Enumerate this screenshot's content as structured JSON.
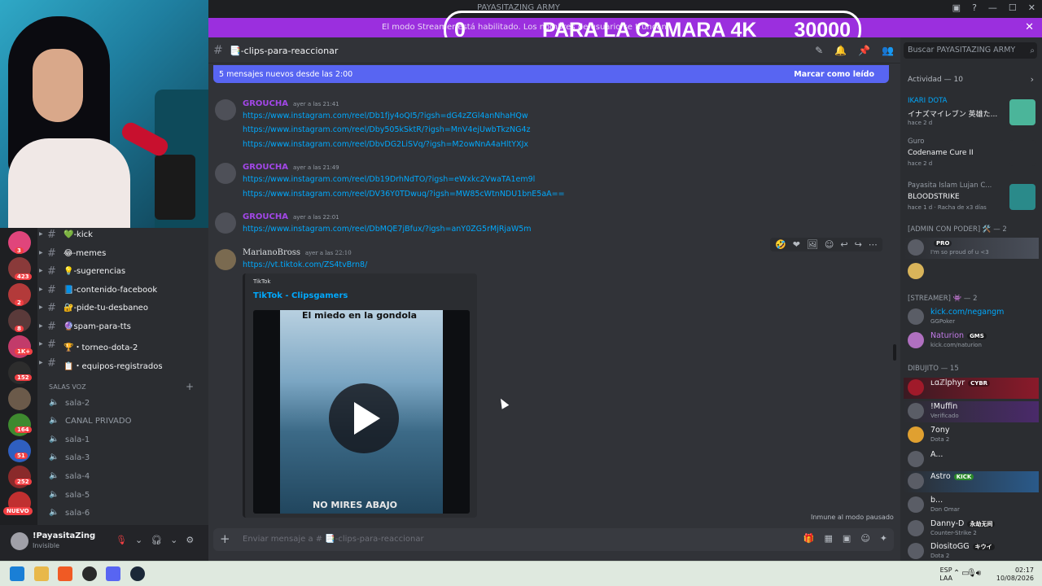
{
  "window": {
    "title": "PAYASITAZING ARMY",
    "controls": [
      "▣",
      "?",
      "—",
      "☐",
      "✕"
    ]
  },
  "banner": {
    "text": "El modo Streamer está habilitado. Los nombres de usuario se truncan.",
    "close": "✕"
  },
  "overlay": {
    "left": "0",
    "middle": "PARA LA CAMARA 4K",
    "right": "30000"
  },
  "channel_header": {
    "hash": "#",
    "name": "📑-clips-para-reaccionar"
  },
  "search": {
    "placeholder": "Buscar PAYASITAZING ARMY"
  },
  "server_badges": [
    "3",
    "423",
    "2",
    "8",
    "1K+",
    "152",
    "164",
    "51",
    "252"
  ],
  "nuevo_badge": "NUEVO",
  "channels": [
    {
      "name": "💚-kick"
    },
    {
      "name": "😂-memes"
    },
    {
      "name": "💡-sugerencias"
    },
    {
      "name": "📘-contenido-facebook"
    },
    {
      "name": "🔐-pide-tu-desbaneo"
    },
    {
      "name": "🔮spam-para-tts"
    },
    {
      "name": "🏆・torneo-dota-2"
    },
    {
      "name": "📋・equipos-registrados"
    }
  ],
  "voice_header": "SALAS VOZ",
  "voice_channels": [
    "sala-2",
    "CANAL PRIVADO",
    "sala-1",
    "sala-3",
    "sala-4",
    "sala-5",
    "sala-6"
  ],
  "user_panel": {
    "name": "!PayasitaZing",
    "status": "Invisible"
  },
  "new_messages": {
    "text": "5 mensajes nuevos desde las 2:00",
    "mark": "Marcar como leído"
  },
  "messages": [
    {
      "author": "GROUCHA",
      "time": "ayer a las 21:41",
      "links": [
        "https://www.instagram.com/reel/Db1fjy4oQI5/?igsh=dG4zZGl4anNhaHQw",
        "https://www.instagram.com/reel/Dby505kSktR/?igsh=MnV4ejUwbTkzNG4z",
        "https://www.instagram.com/reel/DbvDG2LiSVq/?igsh=M2owNnA4aHltYXJx"
      ]
    },
    {
      "author": "GROUCHA",
      "time": "ayer a las 21:49",
      "links": [
        "https://www.instagram.com/reel/Db19DrhNdTO/?igsh=eWxkc2VwaTA1em9l",
        "https://www.instagram.com/reel/DV36Y0TDwuq/?igsh=MW85cWtnNDU1bnE5aA=="
      ]
    },
    {
      "author": "GROUCHA",
      "time": "ayer a las 22:01",
      "links": [
        "https://www.instagram.com/reel/DbMQE7jBfux/?igsh=anY0ZG5rMjRjaW5m"
      ]
    },
    {
      "author": "MarianoBross",
      "time": "ayer a las 22:10",
      "links": [
        "https://vt.tiktok.com/ZS4tvBrn8/"
      ]
    }
  ],
  "embed": {
    "provider": "TikTok",
    "title": "TikTok - Clipsgamers",
    "video_top": "El miedo en la gondola",
    "video_bottom": "NO MIRES ABAJO"
  },
  "immune": "Inmune al modo pausado",
  "composer": {
    "placeholder": "Enviar mensaje a # 📑-clips-para-reaccionar"
  },
  "activity": {
    "header": "Actividad — 10",
    "cards": [
      {
        "user": "IKARI DOTA",
        "title": "イナズマイレブン 英雄た...",
        "sub": "hace 2 d"
      },
      {
        "user": "Guro",
        "title": "Codename Cure II",
        "sub": "hace 2 d"
      },
      {
        "user": "Payasita Islam Lujan C...",
        "title": "BLOODSTRIKE",
        "sub": "hace 1 d · Racha de x3 días"
      }
    ]
  },
  "member_groups": [
    {
      "header": "[ADMIN CON PODER] 🛠️ — 2",
      "members": [
        {
          "name": "",
          "sub": "I'm so proud of u <3",
          "badge": "PRO",
          "color": "#f2f3f5"
        },
        {
          "name": "",
          "sub": "",
          "badge": "",
          "color": "#f2f3f5"
        }
      ]
    },
    {
      "header": "[STREAMER] 👾 — 2",
      "members": [
        {
          "name": "kick.com/negangm",
          "sub": "GGPoker",
          "badge": "",
          "color": "#00a8fc"
        },
        {
          "name": "Naturion",
          "sub": "kick.com/naturion",
          "badge": "GMS",
          "color": "#c27ae8"
        }
      ]
    },
    {
      "header": "DIBUJITO — 15",
      "members": [
        {
          "name": "ʟɑℤlphyr",
          "sub": "",
          "badge": "CYBR",
          "color": "#f2f3f5"
        },
        {
          "name": "!Muffin",
          "sub": "Verificado",
          "badge": "",
          "color": "#f2f3f5"
        },
        {
          "name": "7ony",
          "sub": "Dota 2",
          "badge": "",
          "color": "#f2f3f5"
        },
        {
          "name": "A...",
          "sub": "",
          "badge": "",
          "color": "#f2f3f5"
        },
        {
          "name": "Astro",
          "sub": "",
          "badge": "KICK",
          "color": "#f2f3f5"
        },
        {
          "name": "b...",
          "sub": "Don Omar",
          "badge": "",
          "color": "#f2f3f5"
        },
        {
          "name": "Danny-D",
          "sub": "Counter-Strike 2",
          "badge": "永劫无间",
          "color": "#f2f3f5"
        },
        {
          "name": "DiositoGG",
          "sub": "Dota 2",
          "badge": "キウイ",
          "color": "#f2f3f5"
        }
      ]
    }
  ],
  "taskbar": {
    "lang_top": "ESP",
    "lang_bottom": "LAA",
    "time": "02:17",
    "date": "10/08/2026"
  },
  "colors": {
    "accent": "#5865f2",
    "banner": "#9b2fde",
    "link": "#00a8fc",
    "author_groucha": "#a347e8",
    "author_mariano": "#dbdee1"
  }
}
